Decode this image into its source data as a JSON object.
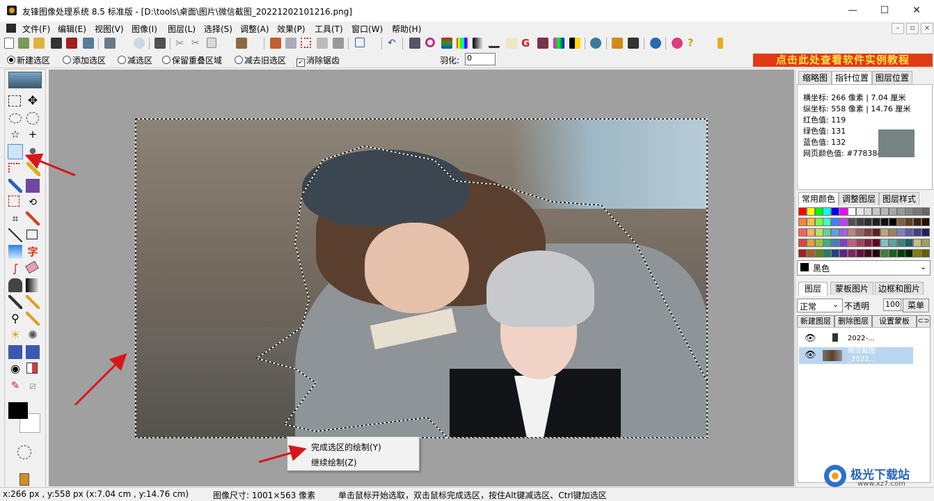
{
  "window": {
    "title": "友锋图像处理系统 8.5 标准版 - [D:\\tools\\桌面\\图片\\微信截图_20221202101216.png]",
    "minimize": "—",
    "maximize": "☐",
    "close": "✕"
  },
  "menu": [
    "文件(F)",
    "编辑(E)",
    "视图(V)",
    "图像(I)",
    "图层(L)",
    "选择(S)",
    "调整(A)",
    "效果(P)",
    "工具(T)",
    "窗口(W)",
    "帮助(H)"
  ],
  "mdi_controls": [
    "–",
    "▫",
    "×"
  ],
  "options": {
    "new_selection": "新建选区",
    "add_selection": "添加选区",
    "subtract_selection": "减选区",
    "keep_overlap": "保留重叠区域",
    "subtract_old": "减去旧选区",
    "antialias": "消除锯齿",
    "feather_label": "羽化:",
    "feather_value": "0",
    "banner": "点击此处查看软件实例教程"
  },
  "context_menu": {
    "finish": "完成选区的绘制(Y)",
    "continue": "继续绘制(Z)"
  },
  "right_panel": {
    "top_tabs": [
      "缩略图",
      "指针位置",
      "图层位置"
    ],
    "pointer": {
      "x_label": "横坐标:",
      "x_px": "266",
      "x_unit": "像素",
      "x_cm": "7.04",
      "y_label": "纵坐标:",
      "y_px": "558",
      "y_unit": "像素",
      "y_cm": "14.76",
      "cm_unit": "厘米",
      "red_label": "红色值:",
      "red": "119",
      "green_label": "绿色值:",
      "green": "131",
      "blue_label": "蓝色值:",
      "blue": "132",
      "web_label": "网页颜色值:",
      "web": "#778384",
      "swatch_color": "#778384"
    },
    "color_tabs": [
      "常用颜色",
      "调整图层",
      "图层样式"
    ],
    "color_select": "黑色",
    "layer_tabs": [
      "图层",
      "蒙板图片",
      "边框和图片"
    ],
    "blend_mode": "正常",
    "opacity_label": "不透明",
    "opacity": "100",
    "menu_button": "菜单",
    "layer_buttons": [
      "新建图层",
      "删除图层",
      "设置蒙板"
    ],
    "layers": [
      {
        "name": "2022-..."
      },
      {
        "name": "微信截图",
        "sub": "_2022..."
      }
    ]
  },
  "status": {
    "coords": "x:266 px , y:558 px (x:7.04 cm , y:14.76 cm)",
    "image_size": "图像尺寸: 1001×563 像素",
    "hint": "单击鼠标开始选取，双击鼠标完成选区，按住Alt键减选区、Ctrl键加选区"
  },
  "watermark": {
    "name": "极光下载站",
    "url": "www.xz7.com"
  },
  "colors": {
    "banner_bg": "#e23a12",
    "banner_text": "#ffe04a",
    "arrow": "#d8161b",
    "selected_layer": "#b9d6f0"
  }
}
